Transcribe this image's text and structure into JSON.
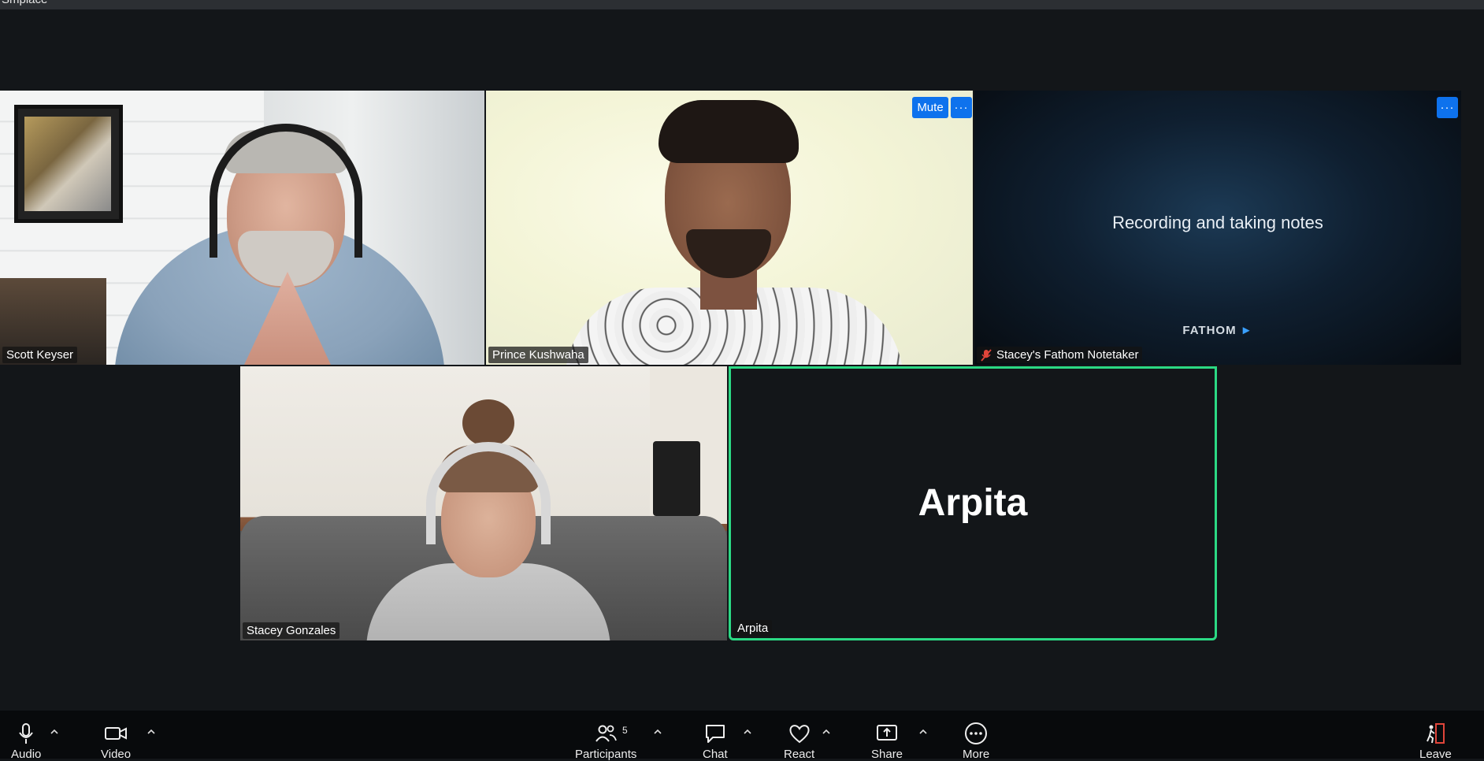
{
  "window": {
    "title": "Smplace"
  },
  "participants": [
    {
      "name": "Scott Keyser",
      "muted": false
    },
    {
      "name": "Prince Kushwaha",
      "muted": false
    },
    {
      "name": "Stacey's Fathom Notetaker",
      "muted": true,
      "overlay_text": "Recording and taking notes",
      "logo_text": "FATHOM"
    },
    {
      "name": "Stacey Gonzales",
      "muted": false
    },
    {
      "name": "Arpita",
      "muted": false,
      "active_speaker": true,
      "placeholder_name": "Arpita"
    }
  ],
  "tile_controls": {
    "mute_label": "Mute",
    "more_label": "···"
  },
  "toolbar": {
    "audio": "Audio",
    "video": "Video",
    "participants": "Participants",
    "participants_count": "5",
    "chat": "Chat",
    "react": "React",
    "share": "Share",
    "more": "More",
    "leave": "Leave"
  },
  "colors": {
    "active_speaker_border": "#2bd984",
    "button_blue": "#0e72ed",
    "mute_icon": "#e0453a",
    "leave_icon": "#e0453a"
  }
}
